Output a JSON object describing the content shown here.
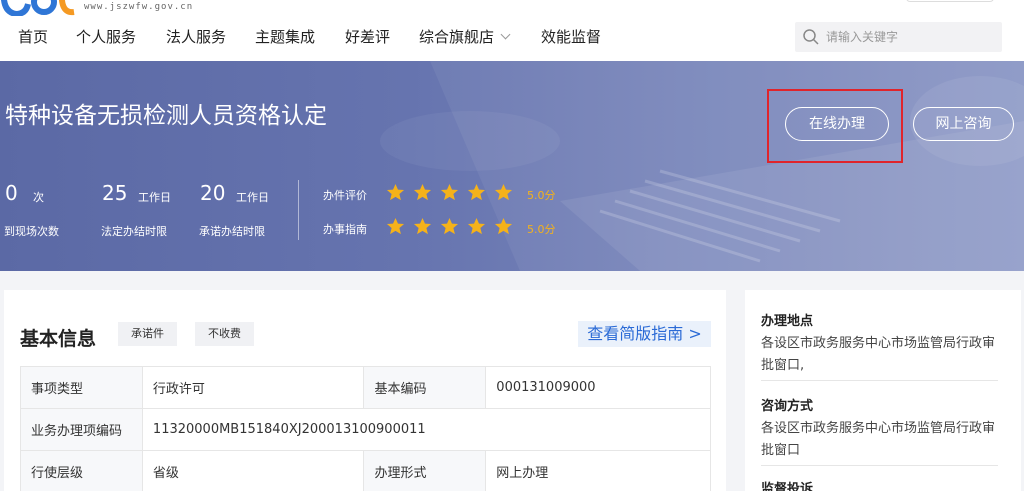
{
  "header": {
    "url_text": "www.jszwfw.gov.cn",
    "nav": [
      "首页",
      "个人服务",
      "法人服务",
      "主题集成",
      "好差评",
      "综合旗舰店",
      "效能监督"
    ],
    "search_placeholder": "请输入关键字"
  },
  "banner": {
    "title": "特种设备无损检测人员资格认定",
    "buttons": {
      "online": "在线办理",
      "consult": "网上咨询"
    },
    "stats": [
      {
        "value": "0",
        "unit": "次",
        "label": "到现场次数"
      },
      {
        "value": "25",
        "unit": "工作日",
        "label": "法定办结时限"
      },
      {
        "value": "20",
        "unit": "工作日",
        "label": "承诺办结时限"
      }
    ],
    "ratings": [
      {
        "label": "办件评价",
        "stars": 5,
        "score": "5.0分"
      },
      {
        "label": "办事指南",
        "stars": 5,
        "score": "5.0分"
      }
    ]
  },
  "basic_info": {
    "title": "基本信息",
    "tags": [
      "承诺件",
      "不收费"
    ],
    "guide_link": "查看简版指南 >",
    "rows": [
      [
        "事项类型",
        "行政许可",
        "基本编码",
        "000131009000"
      ],
      [
        "业务办理项编码",
        "11320000MB151840XJ200013100900011"
      ],
      [
        "行使层级",
        "省级",
        "办理形式",
        "网上办理"
      ]
    ]
  },
  "sidebar": {
    "sections": [
      {
        "title": "办理地点",
        "text": "各设区市政务服务中心市场监管局行政审批窗口,"
      },
      {
        "title": "咨询方式",
        "text": "各设区市政务服务中心市场监管局行政审批窗口"
      },
      {
        "title": "监督投诉",
        "text": ""
      }
    ]
  },
  "colors": {
    "banner": "#6674af",
    "accent_link": "#2a6ad6",
    "star": "#f5b21a",
    "highlight": "#e0242b"
  }
}
